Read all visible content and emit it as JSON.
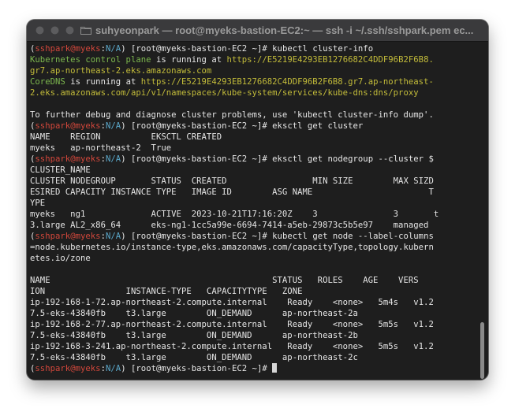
{
  "window": {
    "title": "suhyeonpark — root@myeks-bastion-EC2:~ — ssh -i ~/.ssh/sshpark.pem ec..."
  },
  "colors": {
    "prompt_user": "#d2473b",
    "prompt_na": "#5aa7c9",
    "success": "#7db84e",
    "url": "#c3bc3a",
    "text": "#e6e6e6",
    "background": "#1e1e1e"
  },
  "terminal": {
    "lines": [
      [
        {
          "t": "(",
          "c": "white"
        },
        {
          "t": "sshpark@myeks",
          "c": "red"
        },
        {
          "t": ":",
          "c": "white"
        },
        {
          "t": "N/A",
          "c": "blue"
        },
        {
          "t": ") [root@myeks-bastion-EC2 ~]# kubectl cluster-info",
          "c": "white"
        }
      ],
      [
        {
          "t": "Kubernetes control plane",
          "c": "green"
        },
        {
          "t": " is running at ",
          "c": "white"
        },
        {
          "t": "https://E5219E4293EB1276682C4DDF96B2F6B8.",
          "c": "yellow"
        }
      ],
      [
        {
          "t": "gr7.ap-northeast-2.eks.amazonaws.com",
          "c": "yellow"
        }
      ],
      [
        {
          "t": "CoreDNS",
          "c": "green"
        },
        {
          "t": " is running at ",
          "c": "white"
        },
        {
          "t": "https://E5219E4293EB1276682C4DDF96B2F6B8.gr7.ap-northeast-",
          "c": "yellow"
        }
      ],
      [
        {
          "t": "2.eks.amazonaws.com/api/v1/namespaces/kube-system/services/kube-dns:dns/proxy",
          "c": "yellow"
        }
      ],
      [
        {
          "t": "",
          "c": "white"
        }
      ],
      [
        {
          "t": "To further debug and diagnose cluster problems, use 'kubectl cluster-info dump'.",
          "c": "white"
        }
      ],
      [
        {
          "t": "(",
          "c": "white"
        },
        {
          "t": "sshpark@myeks",
          "c": "red"
        },
        {
          "t": ":",
          "c": "white"
        },
        {
          "t": "N/A",
          "c": "blue"
        },
        {
          "t": ") [root@myeks-bastion-EC2 ~]# eksctl get cluster",
          "c": "white"
        }
      ],
      [
        {
          "t": "NAME    REGION          EKSCTL CREATED",
          "c": "white"
        }
      ],
      [
        {
          "t": "myeks   ap-northeast-2  True",
          "c": "white"
        }
      ],
      [
        {
          "t": "(",
          "c": "white"
        },
        {
          "t": "sshpark@myeks",
          "c": "red"
        },
        {
          "t": ":",
          "c": "white"
        },
        {
          "t": "N/A",
          "c": "blue"
        },
        {
          "t": ") [root@myeks-bastion-EC2 ~]# eksctl get nodegroup --cluster $",
          "c": "white"
        }
      ],
      [
        {
          "t": "CLUSTER_NAME",
          "c": "white"
        }
      ],
      [
        {
          "t": "CLUSTER NODEGROUP       STATUS  CREATED                 MIN SIZE        MAX SIZD",
          "c": "white"
        }
      ],
      [
        {
          "t": "ESIRED CAPACITY INSTANCE TYPE   IMAGE ID        ASG NAME                       T",
          "c": "white"
        }
      ],
      [
        {
          "t": "YPE",
          "c": "white"
        }
      ],
      [
        {
          "t": "myeks   ng1             ACTIVE  2023-10-21T17:16:20Z    3               3       t",
          "c": "white"
        }
      ],
      [
        {
          "t": "3.large AL2_x86_64      eks-ng1-1cc5a99e-6694-7414-a5eb-29873c5b5e97    managed",
          "c": "white"
        }
      ],
      [
        {
          "t": "(",
          "c": "white"
        },
        {
          "t": "sshpark@myeks",
          "c": "red"
        },
        {
          "t": ":",
          "c": "white"
        },
        {
          "t": "N/A",
          "c": "blue"
        },
        {
          "t": ") [root@myeks-bastion-EC2 ~]# kubectl get node --label-columns",
          "c": "white"
        }
      ],
      [
        {
          "t": "=node.kubernetes.io/instance-type,eks.amazonaws.com/capacityType,topology.kubern",
          "c": "white"
        }
      ],
      [
        {
          "t": "etes.io/zone",
          "c": "white"
        }
      ],
      [
        {
          "t": "",
          "c": "white"
        }
      ],
      [
        {
          "t": "NAME                                            STATUS   ROLES    AGE    VERS",
          "c": "white"
        }
      ],
      [
        {
          "t": "ION                INSTANCE-TYPE   CAPACITYTYPE   ZONE",
          "c": "white"
        }
      ],
      [
        {
          "t": "ip-192-168-1-72.ap-northeast-2.compute.internal    Ready    <none>   5m4s   v1.2",
          "c": "white"
        }
      ],
      [
        {
          "t": "7.5-eks-43840fb    t3.large        ON_DEMAND      ap-northeast-2a",
          "c": "white"
        }
      ],
      [
        {
          "t": "ip-192-168-2-77.ap-northeast-2.compute.internal    Ready    <none>   5m5s   v1.2",
          "c": "white"
        }
      ],
      [
        {
          "t": "7.5-eks-43840fb    t3.large        ON_DEMAND      ap-northeast-2b",
          "c": "white"
        }
      ],
      [
        {
          "t": "ip-192-168-3-241.ap-northeast-2.compute.internal   Ready    <none>   5m5s   v1.2",
          "c": "white"
        }
      ],
      [
        {
          "t": "7.5-eks-43840fb    t3.large        ON_DEMAND      ap-northeast-2c",
          "c": "white"
        }
      ],
      [
        {
          "t": "(",
          "c": "white"
        },
        {
          "t": "sshpark@myeks",
          "c": "red"
        },
        {
          "t": ":",
          "c": "white"
        },
        {
          "t": "N/A",
          "c": "blue"
        },
        {
          "t": ") [root@myeks-bastion-EC2 ~]# ",
          "c": "white"
        }
      ]
    ]
  }
}
